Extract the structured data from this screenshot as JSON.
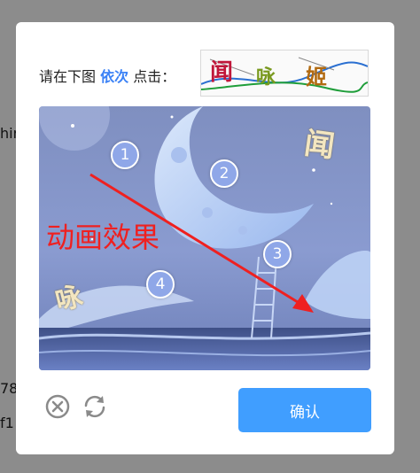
{
  "background_text": [
    "hir",
    "78",
    "f1"
  ],
  "prompt": {
    "prefix": "请在下图",
    "highlight": "依次",
    "suffix": "点击："
  },
  "captcha_sample": {
    "chars": [
      "闻",
      "咏",
      "姬"
    ]
  },
  "image_glyphs": [
    "闻",
    "咏"
  ],
  "markers": [
    "1",
    "2",
    "3",
    "4"
  ],
  "overlay_label": "动画效果",
  "buttons": {
    "confirm": "确认"
  },
  "icons": {
    "close": "close-circle-icon",
    "refresh": "refresh-icon"
  },
  "colors": {
    "accent": "#409eff",
    "highlight": "#3b82f6",
    "marker": "#8fa7e8",
    "arrow": "#ef2020"
  }
}
